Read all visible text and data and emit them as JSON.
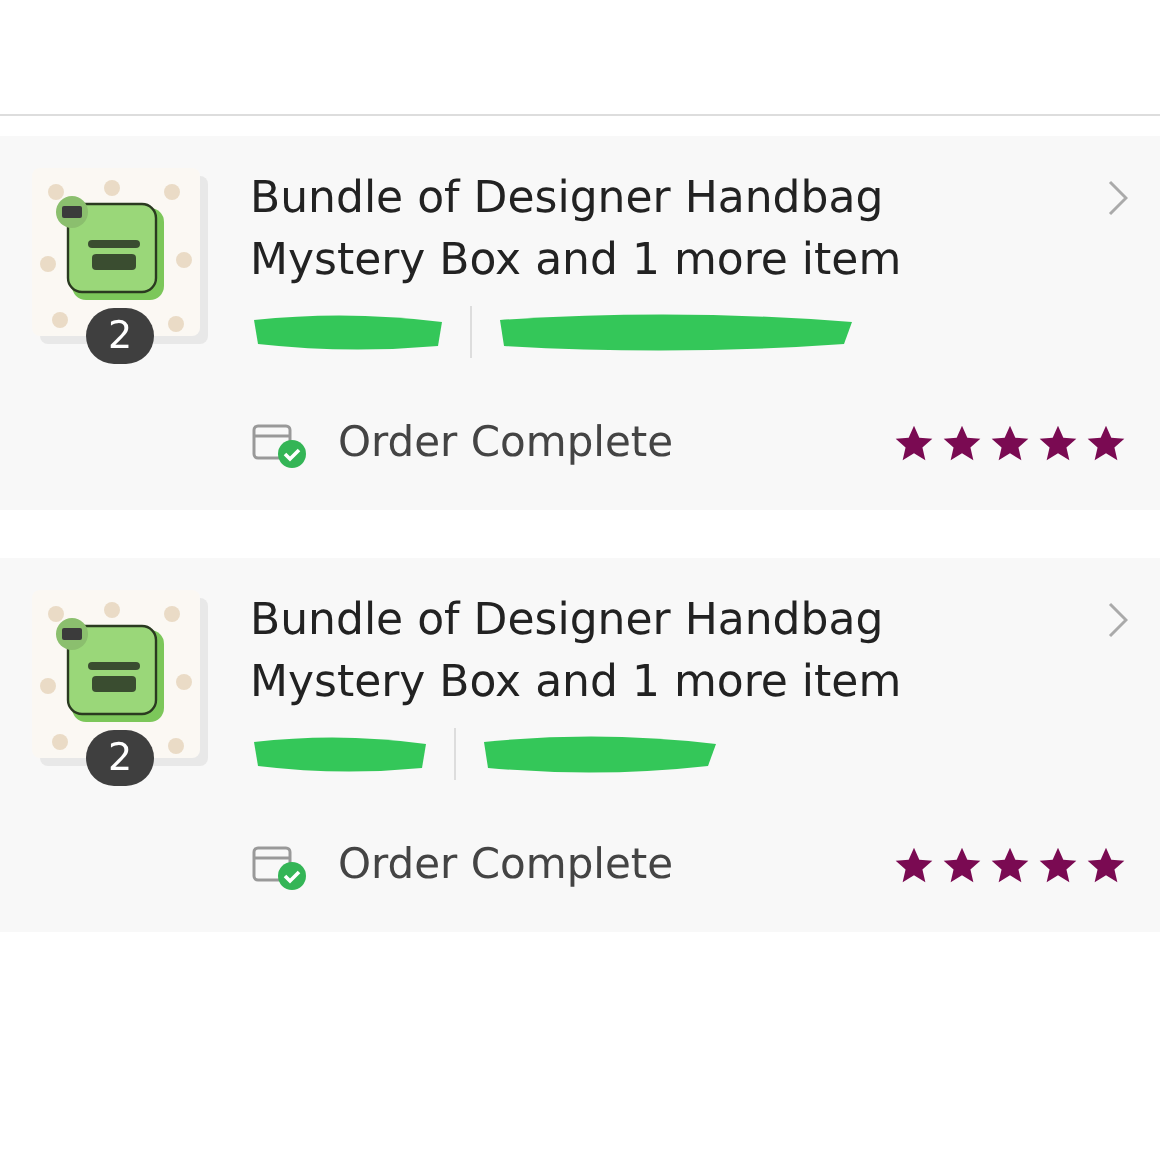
{
  "orders": [
    {
      "item_count": "2",
      "title": "Bundle of Designer Handbag Mystery Box and 1 more item",
      "status": "Order Complete",
      "stars": 5
    },
    {
      "item_count": "2",
      "title": "Bundle of Designer Handbag Mystery Box and 1 more item",
      "status": "Order Complete",
      "stars": 5
    }
  ]
}
